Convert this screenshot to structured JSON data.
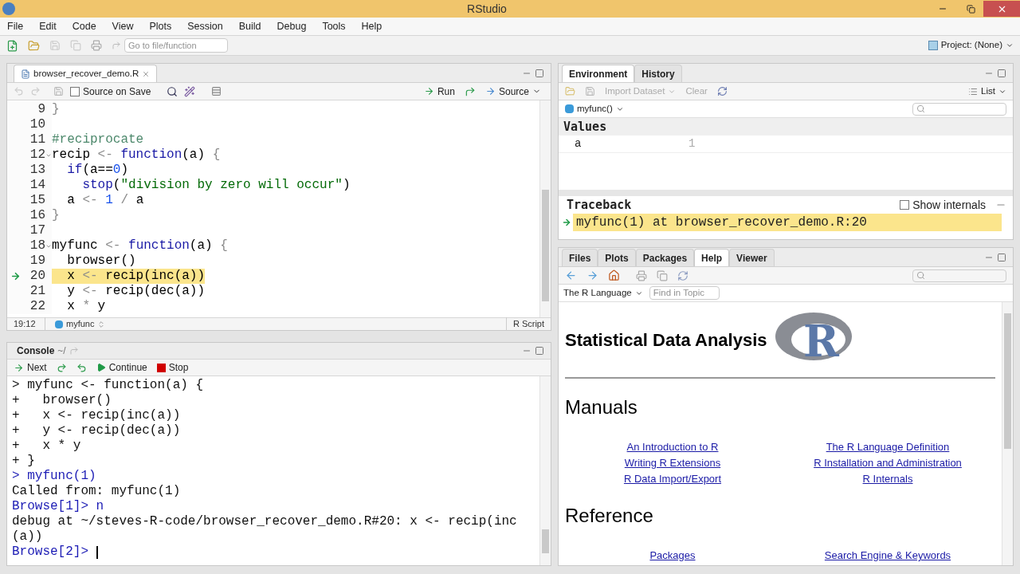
{
  "window": {
    "title": "RStudio"
  },
  "menu": [
    "File",
    "Edit",
    "Code",
    "View",
    "Plots",
    "Session",
    "Build",
    "Debug",
    "Tools",
    "Help"
  ],
  "toolbar": {
    "goto_placeholder": "Go to file/function",
    "project": "Project: (None)"
  },
  "editor": {
    "tabs": [
      {
        "label": "browser_recover_demo.R",
        "selected": true
      }
    ],
    "source_on_save": {
      "label": "Source on Save",
      "checked": false
    },
    "run": "Run",
    "source": "Source",
    "lines": [
      {
        "number": "9",
        "foldable": false,
        "current": false,
        "tokens": [
          {
            "text": "}",
            "kind": "operator"
          }
        ]
      },
      {
        "number": "10",
        "foldable": false,
        "current": false
      },
      {
        "number": "11",
        "foldable": false,
        "current": false,
        "tokens": [
          {
            "text": "#reciprocate",
            "kind": "comment"
          }
        ]
      },
      {
        "number": "12",
        "foldable": true,
        "current": false,
        "tokens": [
          {
            "text": "recip ",
            "kind": "plain"
          },
          {
            "text": "<-",
            "kind": "operator"
          },
          {
            "text": " function",
            "kind": "keyword"
          },
          {
            "text": "(a) ",
            "kind": "plain"
          },
          {
            "text": "{",
            "kind": "operator"
          }
        ]
      },
      {
        "number": "13",
        "foldable": false,
        "current": false,
        "tokens": [
          {
            "text": "  if",
            "kind": "keyword"
          },
          {
            "text": "(a==",
            "kind": "plain"
          },
          {
            "text": "0",
            "kind": "number"
          },
          {
            "text": ")",
            "kind": "plain"
          }
        ]
      },
      {
        "number": "14",
        "foldable": false,
        "current": false,
        "tokens": [
          {
            "text": "    stop",
            "kind": "keyword"
          },
          {
            "text": "(",
            "kind": "plain"
          },
          {
            "text": "\"division by zero will occur\"",
            "kind": "string"
          },
          {
            "text": ")",
            "kind": "plain"
          }
        ]
      },
      {
        "number": "15",
        "foldable": false,
        "current": false,
        "tokens": [
          {
            "text": "  a ",
            "kind": "plain"
          },
          {
            "text": "<-",
            "kind": "operator"
          },
          {
            "text": " 1",
            "kind": "number"
          },
          {
            "text": " / ",
            "kind": "operator"
          },
          {
            "text": "a",
            "kind": "plain"
          }
        ]
      },
      {
        "number": "16",
        "foldable": false,
        "current": false,
        "tokens": [
          {
            "text": "}",
            "kind": "operator"
          }
        ]
      },
      {
        "number": "17",
        "foldable": false,
        "current": false
      },
      {
        "number": "18",
        "foldable": true,
        "current": false,
        "tokens": [
          {
            "text": "myfunc ",
            "kind": "plain"
          },
          {
            "text": "<-",
            "kind": "operator"
          },
          {
            "text": " function",
            "kind": "keyword"
          },
          {
            "text": "(a) ",
            "kind": "plain"
          },
          {
            "text": "{",
            "kind": "operator"
          }
        ]
      },
      {
        "number": "19",
        "foldable": false,
        "current": false,
        "tokens": [
          {
            "text": "  browser()",
            "kind": "plain"
          }
        ]
      },
      {
        "number": "20",
        "foldable": false,
        "current": true,
        "tokens": [
          {
            "text": "  x ",
            "kind": "plain"
          },
          {
            "text": "<-",
            "kind": "operator"
          },
          {
            "text": " recip(inc(a))",
            "kind": "plain"
          }
        ]
      },
      {
        "number": "21",
        "foldable": false,
        "current": false,
        "tokens": [
          {
            "text": "  y ",
            "kind": "plain"
          },
          {
            "text": "<-",
            "kind": "operator"
          },
          {
            "text": " recip(dec(a))",
            "kind": "plain"
          }
        ]
      },
      {
        "number": "22",
        "foldable": false,
        "current": false,
        "tokens": [
          {
            "text": "  x ",
            "kind": "plain"
          },
          {
            "text": "*",
            "kind": "operator"
          },
          {
            "text": " y",
            "kind": "plain"
          }
        ]
      }
    ],
    "status": {
      "position": "19:12",
      "scope": "myfunc",
      "file_type": "R Script"
    }
  },
  "console": {
    "title": "Console",
    "path": "~/",
    "next": "Next",
    "continue": "Continue",
    "stop": "Stop",
    "lines": [
      {
        "text": "> myfunc <- function(a) {",
        "kind": "output",
        "cursor": false
      },
      {
        "text": "+   browser()",
        "kind": "output",
        "cursor": false
      },
      {
        "text": "+   x <- recip(inc(a))",
        "kind": "output",
        "cursor": false
      },
      {
        "text": "+   y <- recip(dec(a))",
        "kind": "output",
        "cursor": false
      },
      {
        "text": "+   x * y",
        "kind": "output",
        "cursor": false
      },
      {
        "text": "+ }",
        "kind": "output",
        "cursor": false
      },
      {
        "text": "> myfunc(1)",
        "kind": "input",
        "cursor": false
      },
      {
        "text": "Called from: myfunc(1)",
        "kind": "output",
        "cursor": false
      },
      {
        "text": "Browse[1]> n",
        "kind": "input",
        "cursor": false
      },
      {
        "text": "debug at ~/steves-R-code/browser_recover_demo.R#20: x <- recip(inc",
        "kind": "output",
        "cursor": false
      },
      {
        "text": "(a))",
        "kind": "output",
        "cursor": false
      },
      {
        "text": "Browse[2]> ",
        "kind": "input",
        "cursor": true
      }
    ]
  },
  "environment": {
    "tabs": [
      {
        "label": "Environment",
        "selected": true
      },
      {
        "label": "History",
        "selected": false
      }
    ],
    "import": "Import Dataset",
    "clear": "Clear",
    "view": "List",
    "scope": "myfunc()",
    "section": "Values",
    "values": [
      {
        "name": "a",
        "value": "1"
      }
    ],
    "traceback": {
      "title": "Traceback",
      "show_internals": {
        "label": "Show internals",
        "checked": false
      },
      "frames": [
        {
          "text": "myfunc(1) at browser_recover_demo.R:20",
          "current": true
        }
      ]
    }
  },
  "help": {
    "tabs": [
      {
        "label": "Files",
        "selected": false
      },
      {
        "label": "Plots",
        "selected": false
      },
      {
        "label": "Packages",
        "selected": false
      },
      {
        "label": "Help",
        "selected": true
      },
      {
        "label": "Viewer",
        "selected": false
      }
    ],
    "topic": "The R Language",
    "find_placeholder": "Find in Topic",
    "heading": "Statistical Data Analysis",
    "logo_letter": "R",
    "sections": [
      {
        "title": "Manuals",
        "columns": [
          [
            "An Introduction to R",
            "Writing R Extensions",
            "R Data Import/Export"
          ],
          [
            "The R Language Definition",
            "R Installation and Administration",
            "R Internals"
          ]
        ]
      },
      {
        "title": "Reference",
        "columns": [
          [
            "Packages"
          ],
          [
            "Search Engine & Keywords"
          ]
        ]
      }
    ]
  }
}
